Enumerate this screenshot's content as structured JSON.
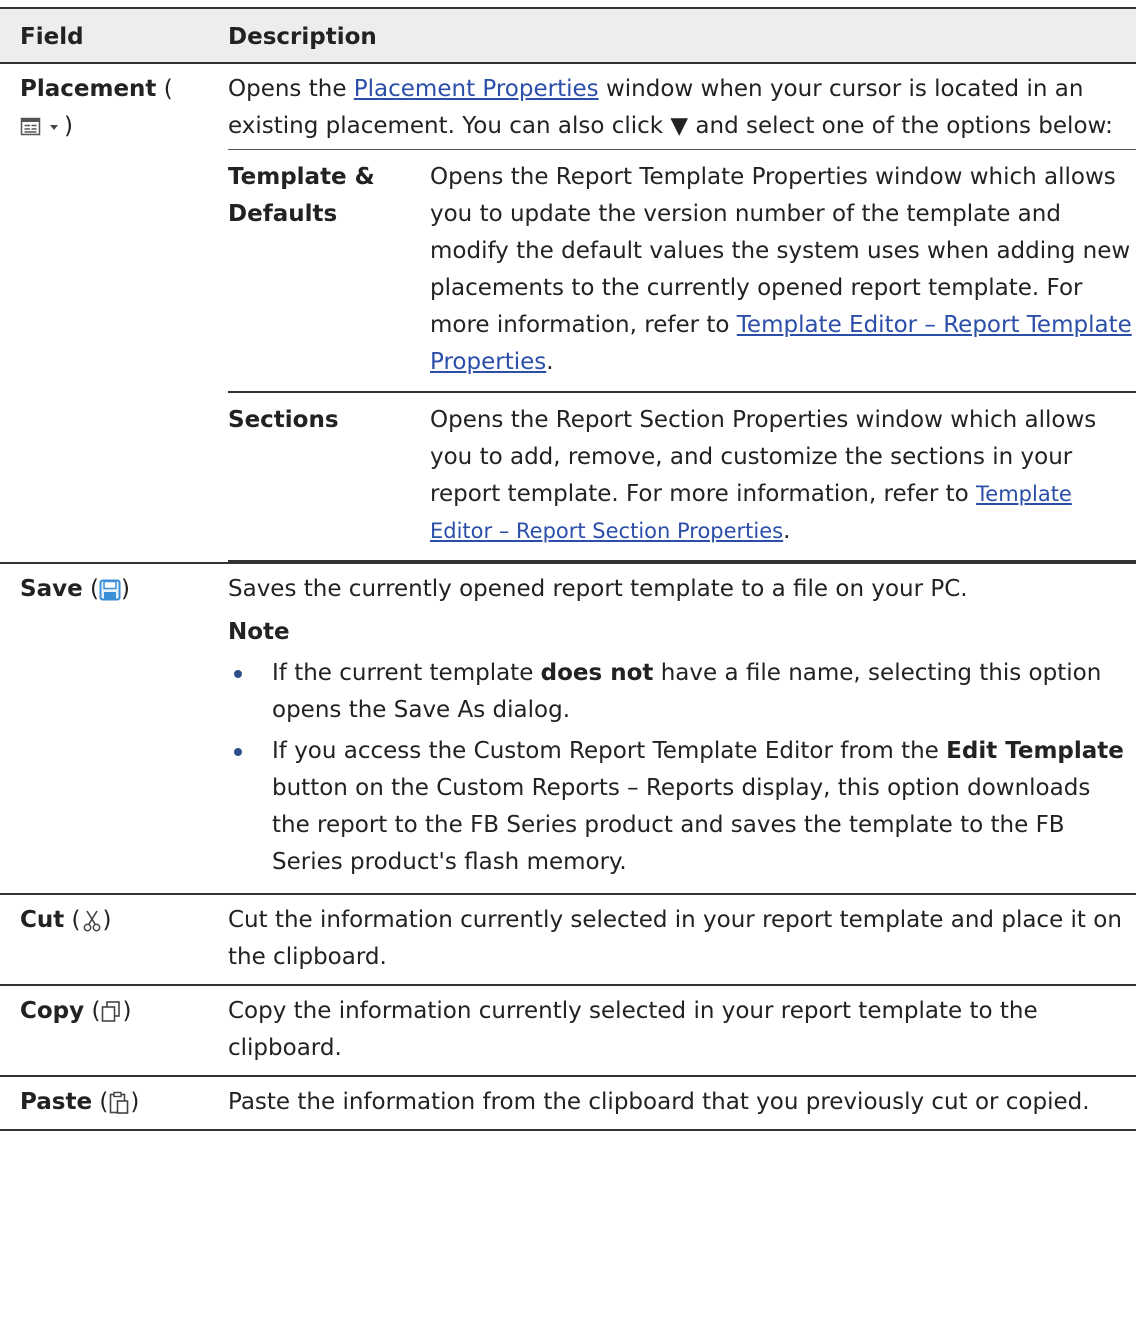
{
  "table": {
    "headers": {
      "field": "Field",
      "description": "Description"
    },
    "placement": {
      "name": "Placement",
      "paren_open": " (",
      "paren_close": ")",
      "icon": "placement-properties-icon",
      "desc_before": "Opens the ",
      "desc_link": "Placement Properties",
      "desc_after": " window when your cursor is located in an existing placement. You can also click ▼ and select one of the options below:",
      "options": [
        {
          "name": "Template & Defaults",
          "desc_before": "Opens the Report Template Properties window which allows you to update the version number of the template and modify the default values the system uses when adding new placements to the currently opened report template. For more information, refer to ",
          "desc_link": "Template Editor – Report Template Properties",
          "desc_after": "."
        },
        {
          "name": "Sections",
          "desc_before": "Opens the Report Section Properties window which allows you to add, remove, and customize the sections in your report template. For more information, refer to ",
          "desc_link": "Template Editor – Report Section Properties",
          "desc_after": "."
        }
      ]
    },
    "save": {
      "name": "Save",
      "paren_open": " (",
      "paren_close": ")",
      "icon": "save-icon",
      "desc": "Saves the currently opened report template to a file on your PC.",
      "note_label": "Note",
      "bullet1_before": "If the current template ",
      "bullet1_bold": "does not",
      "bullet1_after": " have a file name, selecting this option opens the Save As dialog.",
      "bullet2_before": "If you access the Custom Report Template Editor from the ",
      "bullet2_bold": "Edit Template",
      "bullet2_after": " button on the Custom Reports – Reports display, this option downloads the report to the FB Series product and saves the template to the FB Series product's flash memory."
    },
    "cut": {
      "name": "Cut",
      "paren_open": " (",
      "paren_close": ")",
      "icon": "scissors-icon",
      "desc": "Cut the information currently selected in your report template and place it on the clipboard."
    },
    "copy": {
      "name": "Copy",
      "paren_open": " (",
      "paren_close": ")",
      "icon": "copy-icon",
      "desc": "Copy the information currently selected in your report template to the clipboard."
    },
    "paste": {
      "name": "Paste",
      "paren_open": " (",
      "paren_close": ")",
      "icon": "paste-icon",
      "desc": "Paste the information from the clipboard that you previously cut or copied."
    }
  },
  "colors": {
    "link": "#2b4fa8",
    "header_bg": "#ededed",
    "save_icon": "#3a8fd6"
  }
}
